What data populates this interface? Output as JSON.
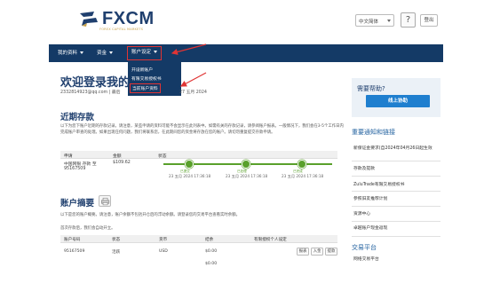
{
  "brand": {
    "logo_text": "FXCM",
    "tagline": "FOREX CAPITAL MARKETS"
  },
  "header": {
    "language": "中文简体",
    "help_symbol": "?",
    "logout_label": "登出"
  },
  "nav": {
    "items": [
      {
        "label": "我的资料"
      },
      {
        "label": "资金"
      },
      {
        "label": "账户设定"
      }
    ]
  },
  "dropdown": {
    "items": [
      {
        "label": "开设新账户"
      },
      {
        "label": "有限交易授权书"
      },
      {
        "label": "当前账户资料"
      }
    ]
  },
  "welcome": {
    "title": "欢迎登录我的",
    "email_line": "2332814923@qq.com | 最后",
    "last_login": "27 五月 2024"
  },
  "deposits": {
    "title": "近期存款",
    "intro": "以下为您下账户近期的存款记录。请注意，某些申请的资料可能不会显示在此列表中。如需有关的存款记录，请参阅账户报表。一般情况下，我们会在3-5个工作日内完成账户审查的处理。如果出现任何问题，我们将联系您，在此期间您的资金将存放在您的账户。请切勿重复提交存款申请。",
    "headers": {
      "apply": "申请",
      "amount": "金额",
      "status": "状态"
    },
    "row": {
      "account": "中国网银 存款 至",
      "account_no": "95167509",
      "amount": "$109.62"
    },
    "progress": [
      {
        "label": "已提交",
        "date": "23 五月 2024 17:36:18"
      },
      {
        "label": "已处理",
        "date": "23 五月 2024 17:36:18"
      },
      {
        "label": "已完成",
        "date": "23 五月 2024 17:36:18"
      }
    ]
  },
  "accounts": {
    "title": "账户摘要",
    "intro": "以下是您的账户概要。请注意，账户余额不包括开仓后的浮动余额。请登录您的交易平台查看实时余额。",
    "intro2": "首次存款后，我们会自动开立。",
    "headers": {
      "account_no": "账户号码",
      "status": "状态",
      "currency": "货币",
      "balance": "结余",
      "limited": "有限授权个人设定"
    },
    "row": {
      "account_no": "95167509",
      "status": "活跃",
      "currency": "USD",
      "balance": "$0.00",
      "btn_report": "报表",
      "btn_deposit": "入金",
      "btn_withdraw": "提款"
    },
    "total": "$0.00"
  },
  "sidebar": {
    "help_title": "需要帮助?",
    "online_help": "线上协助",
    "notice_title": "重要通知和链接",
    "links": [
      {
        "label": "新保证金要求(自2024年04月26日起生效"
      },
      {
        "label": "存款及提款"
      },
      {
        "label": "ZuluTrade有限交易授权书"
      },
      {
        "label": "参照旧友推荐计划"
      },
      {
        "label": "资源中心"
      },
      {
        "label": "卓越账户现金返现"
      }
    ],
    "platform_title": "交易平台",
    "platform_link": "网络交易平台"
  }
}
